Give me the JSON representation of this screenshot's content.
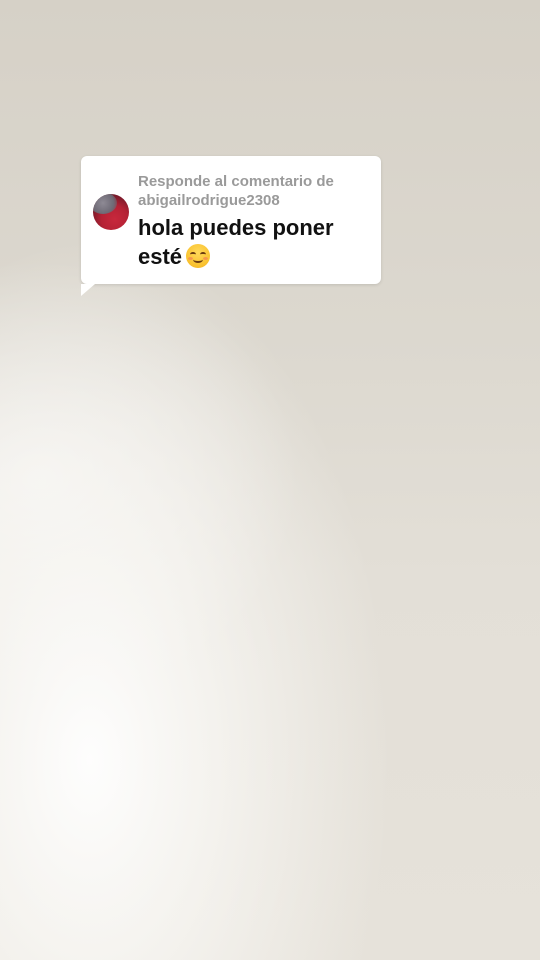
{
  "reply_sticker": {
    "label": "Responde al comentario de",
    "username": "abigailrodrigue2308",
    "comment": "hola puedes poner esté",
    "emoji": "smiling-face-with-smiling-eyes",
    "avatar": "user-avatar"
  }
}
